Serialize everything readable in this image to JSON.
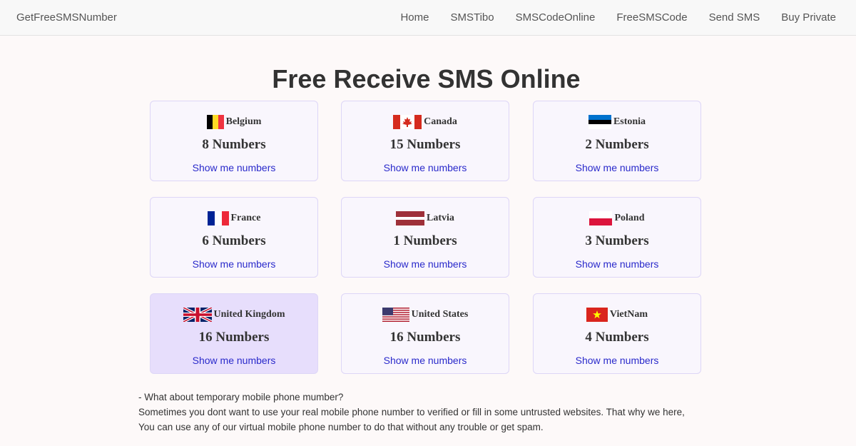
{
  "navbar": {
    "brand": "GetFreeSMSNumber",
    "links": [
      "Home",
      "SMSTibo",
      "SMSCodeOnline",
      "FreeSMSCode",
      "Send SMS",
      "Buy Private"
    ]
  },
  "main": {
    "title": "Free Receive SMS Online",
    "cards": [
      {
        "country": "Belgium",
        "count": "8 Numbers",
        "link": "Show me numbers",
        "flag_icon": "belgium-flag-icon"
      },
      {
        "country": "Canada",
        "count": "15 Numbers",
        "link": "Show me numbers",
        "flag_icon": "canada-flag-icon"
      },
      {
        "country": "Estonia",
        "count": "2 Numbers",
        "link": "Show me numbers",
        "flag_icon": "estonia-flag-icon"
      },
      {
        "country": "France",
        "count": "6 Numbers",
        "link": "Show me numbers",
        "flag_icon": "france-flag-icon"
      },
      {
        "country": "Latvia",
        "count": "1 Numbers",
        "link": "Show me numbers",
        "flag_icon": "latvia-flag-icon"
      },
      {
        "country": "Poland",
        "count": "3 Numbers",
        "link": "Show me numbers",
        "flag_icon": "poland-flag-icon"
      },
      {
        "country": "United Kingdom",
        "count": "16 Numbers",
        "link": "Show me numbers",
        "flag_icon": "uk-flag-icon"
      },
      {
        "country": "United States",
        "count": "16 Numbers",
        "link": "Show me numbers",
        "flag_icon": "us-flag-icon"
      },
      {
        "country": "VietNam",
        "count": "4 Numbers",
        "link": "Show me numbers",
        "flag_icon": "vietnam-flag-icon"
      }
    ],
    "info": {
      "question": "- What about temporary mobile phone mumber?",
      "line1": "Sometimes you dont want to use your real mobile phone number to verified or fill in some untrusted websites. That why we here,",
      "line2": "You can use any of our virtual mobile phone number to do that without any trouble or get spam."
    }
  },
  "colors": {
    "link": "#2a2acb",
    "card_bg": "#f9f6fd",
    "card_active_bg": "#e7defc",
    "card_border": "#ddd6f7",
    "page_bg": "#fdf9f9"
  }
}
